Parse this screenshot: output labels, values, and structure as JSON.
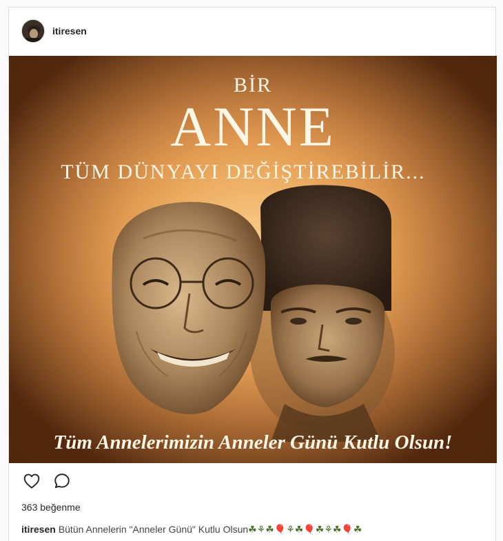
{
  "post": {
    "username": "itiresen",
    "image": {
      "line_top": "BİR",
      "line_big": "ANNE",
      "line_sub": "TÜM DÜNYAYI DEĞİŞTİREBİLİR...",
      "line_bottom": "Tüm Annelerimizin Anneler Günü Kutlu Olsun!"
    },
    "likes_text": "363 beğenme",
    "caption": {
      "username": "itiresen",
      "text": "Bütün Annelerin \"Anneler Günü\" Kutlu Olsun",
      "emoji": "☘⚘☘🎈⚘☘🎈☘⚘☘🎈☘"
    }
  },
  "icons": {
    "like": "heart-outline-icon",
    "comment": "comment-bubble-icon"
  },
  "colors": {
    "text": "#262626",
    "border": "#dbdbdb",
    "poster_cream": "#fff6e6",
    "poster_sepia": "#6a4a2a"
  }
}
